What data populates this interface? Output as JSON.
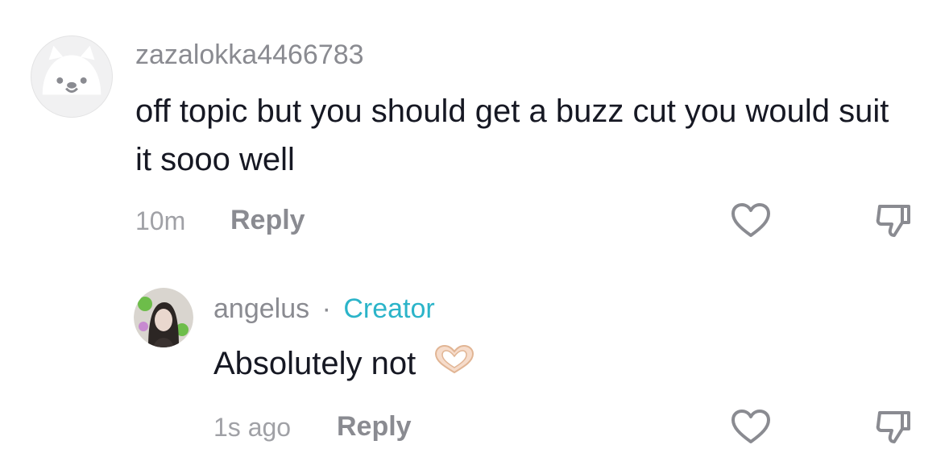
{
  "comment": {
    "username": "zazalokka4466783",
    "text": "off topic but you should get a buzz cut you would suit it sooo well",
    "time": "10m",
    "reply_label": "Reply",
    "avatar_icon": "default-cat-avatar-icon"
  },
  "reply": {
    "username": "angelus",
    "separator": "·",
    "badge": "Creator",
    "text": "Absolutely not",
    "emoji_icon": "heart-hands-icon",
    "time": "1s ago",
    "reply_label": "Reply"
  },
  "colors": {
    "badge": "#2bb4c9",
    "muted": "#8a8b91",
    "text": "#161823"
  }
}
